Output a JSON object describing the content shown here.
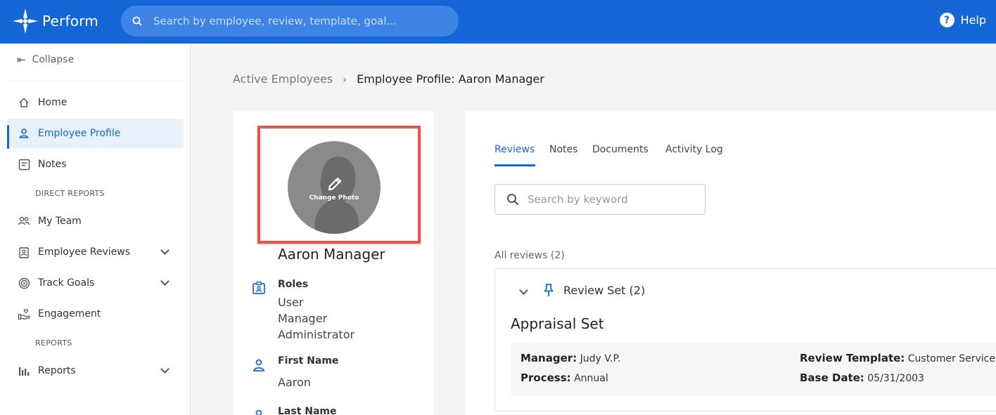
{
  "app": {
    "name": "Perform",
    "search_placeholder": "Search by employee, review, template, goal...",
    "help_label": "Help"
  },
  "sidebar": {
    "collapse_label": "Collapse",
    "items": [
      {
        "label": "Home",
        "icon": "home-icon"
      },
      {
        "label": "Employee Profile",
        "icon": "person-icon",
        "active": true
      },
      {
        "label": "Notes",
        "icon": "notes-icon"
      },
      {
        "label": "My Team",
        "icon": "team-icon"
      },
      {
        "label": "Employee Reviews",
        "icon": "review-icon",
        "expandable": true
      },
      {
        "label": "Track Goals",
        "icon": "target-icon",
        "expandable": true
      },
      {
        "label": "Engagement",
        "icon": "engagement-icon"
      },
      {
        "label": "Reports",
        "icon": "bar-chart-icon",
        "expandable": true
      }
    ],
    "sections": {
      "direct_reports": "DIRECT REPORTS",
      "reports": "REPORTS"
    }
  },
  "breadcrumb": {
    "parent": "Active Employees",
    "current": "Employee Profile: Aaron Manager"
  },
  "profile": {
    "change_photo_label": "Change Photo",
    "name": "Aaron Manager",
    "roles_label": "Roles",
    "roles": [
      "User",
      "Manager",
      "Administrator"
    ],
    "first_name_label": "First Name",
    "first_name": "Aaron",
    "last_name_label": "Last Name"
  },
  "tabs": [
    {
      "label": "Reviews",
      "active": true
    },
    {
      "label": "Notes"
    },
    {
      "label": "Documents"
    },
    {
      "label": "Activity Log"
    }
  ],
  "reviews": {
    "search_placeholder": "Search by keyword",
    "all_reviews_label": "All reviews (2)",
    "set_title": "Review Set (2)",
    "appraisal_title": "Appraisal Set",
    "manager_label": "Manager:",
    "manager_value": "Judy V.P.",
    "process_label": "Process:",
    "process_value": "Annual",
    "template_label": "Review Template:",
    "template_value": "Customer Service",
    "base_date_label": "Base Date:",
    "base_date_value": "05/31/2003"
  },
  "colors": {
    "brand": "#1466d6",
    "highlight": "#e8544a"
  }
}
